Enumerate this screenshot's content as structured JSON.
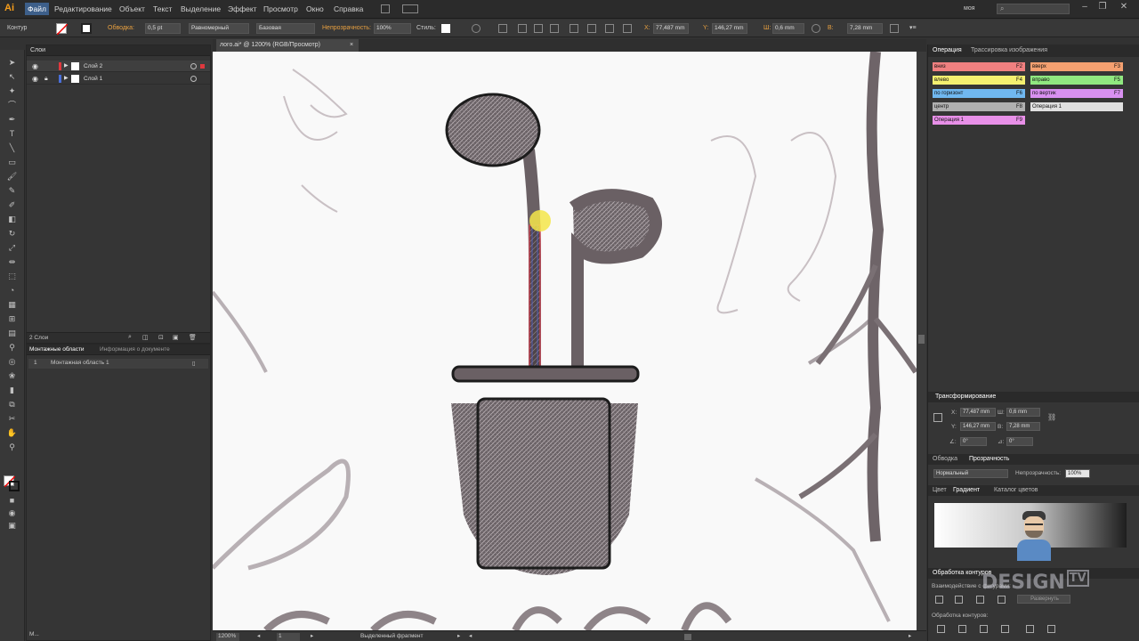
{
  "app": {
    "logo": "Ai",
    "menu": [
      "Файл",
      "Редактирование",
      "Объект",
      "Текст",
      "Выделение",
      "Эффект",
      "Просмотр",
      "Окно",
      "Справка"
    ],
    "workspace": "моя",
    "window_buttons": [
      "–",
      "❐",
      "✕"
    ]
  },
  "control_bar": {
    "mode": "Контур",
    "stroke_label": "Обводка:",
    "stroke_value": "0,5 pt",
    "profile": "Равномерный",
    "brush": "Базовая",
    "opacity_label": "Непрозрачность:",
    "opacity_value": "100%",
    "styles_label": "Стиль:",
    "x_label": "X:",
    "x_value": "77,487 mm",
    "y_label": "Y:",
    "y_value": "146,27 mm",
    "w_label": "Ш:",
    "w_value": "0,6 mm",
    "h_label": "В:",
    "h_value": "7,28 mm"
  },
  "document": {
    "tab_title": "лого.ai* @ 1200% (RGB/Просмотр)",
    "tab_close": "×",
    "zoom": "1200%",
    "artboard_num": "1",
    "status_text": "Выделенный фрагмент"
  },
  "layers_panel": {
    "title": "Слои",
    "layers": [
      {
        "name": "Слой 2",
        "color": "#e0383e",
        "selected": true
      },
      {
        "name": "Слой 1",
        "color": "#4a6fd8",
        "selected": false
      }
    ],
    "footer_count": "2 Слои"
  },
  "artboards_panel": {
    "tab1": "Монтажные области",
    "tab2": "Информация о документе",
    "artboard_index": "1",
    "artboard_name": "Монтажная область 1",
    "footer": "M..."
  },
  "actions_panel": {
    "tab1": "Операция",
    "tab2": "Трассировка изображения",
    "actions": [
      {
        "label": "вниз",
        "key": "F2",
        "color": "#f08080"
      },
      {
        "label": "вверх",
        "key": "F3",
        "color": "#f4a070"
      },
      {
        "label": "влево",
        "key": "F4",
        "color": "#f4f070"
      },
      {
        "label": "вправо",
        "key": "F5",
        "color": "#90e880"
      },
      {
        "label": "по горизонт",
        "key": "F6",
        "color": "#70b8f0"
      },
      {
        "label": "по вертик",
        "key": "F7",
        "color": "#d890f0"
      },
      {
        "label": "центр",
        "key": "F8",
        "color": "#b0b0b0"
      },
      {
        "label": "Операция 1",
        "key": "",
        "color": "#e0e0e0"
      },
      {
        "label": "Операция 1",
        "key": "F9",
        "color": "#e890e8"
      }
    ]
  },
  "transform_panel": {
    "title": "Трансформирование",
    "x_label": "X:",
    "x_value": "77,487 mm",
    "w_label": "Ш:",
    "w_value": "0,6 mm",
    "y_label": "Y:",
    "y_value": "146,27 mm",
    "h_label": "В:",
    "h_value": "7,28 mm",
    "rot_label": "∠:",
    "rot_value": "0°",
    "shear_label": "⊿:",
    "shear_value": "0°"
  },
  "transparency_panel": {
    "tab1": "Обводка",
    "tab2": "Прозрачность",
    "blend": "Нормальный",
    "opacity_label": "Непрозрачность:",
    "opacity_value": "100%"
  },
  "gradient_panel": {
    "tab1": "Цвет",
    "tab2": "Градиент",
    "tab3": "Каталог цветов"
  },
  "pathfinder_panel": {
    "title": "Обработка контуров",
    "shape_modes": "Взаимодействие с фигурами:",
    "expand": "Развернуть",
    "pathfinders": "Обработка контуров:"
  },
  "watermark": {
    "brand": "DESIGN",
    "tv": "TV"
  }
}
